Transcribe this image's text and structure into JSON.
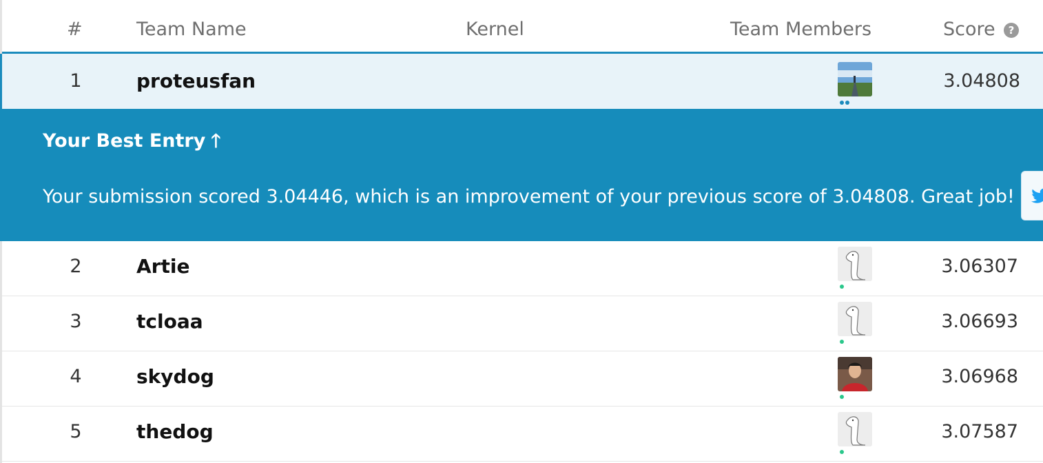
{
  "header": {
    "rank": "#",
    "team_name": "Team Name",
    "kernel": "Kernel",
    "team_members": "Team Members",
    "score": "Score",
    "help_icon": "?"
  },
  "rows": [
    {
      "rank": "1",
      "team": "proteusfan",
      "score": "3.04808",
      "avatar": "landscape-road-avatar"
    },
    {
      "rank": "2",
      "team": "Artie",
      "score": "3.06307",
      "avatar": "goose-avatar"
    },
    {
      "rank": "3",
      "team": "tcloaa",
      "score": "3.06693",
      "avatar": "goose-avatar"
    },
    {
      "rank": "4",
      "team": "skydog",
      "score": "3.06968",
      "avatar": "person-photo-avatar"
    },
    {
      "rank": "5",
      "team": "thedog",
      "score": "3.07587",
      "avatar": "goose-avatar"
    }
  ],
  "banner": {
    "title": "Your Best Entry",
    "arrow": "🡑",
    "message": "Your submission scored 3.04446, which is an improvement of your previous score of 3.04808. Great job!"
  },
  "colors": {
    "accent": "#168cbb",
    "highlight_row": "#e8f3f9",
    "status_dot": "#2ac78b"
  }
}
